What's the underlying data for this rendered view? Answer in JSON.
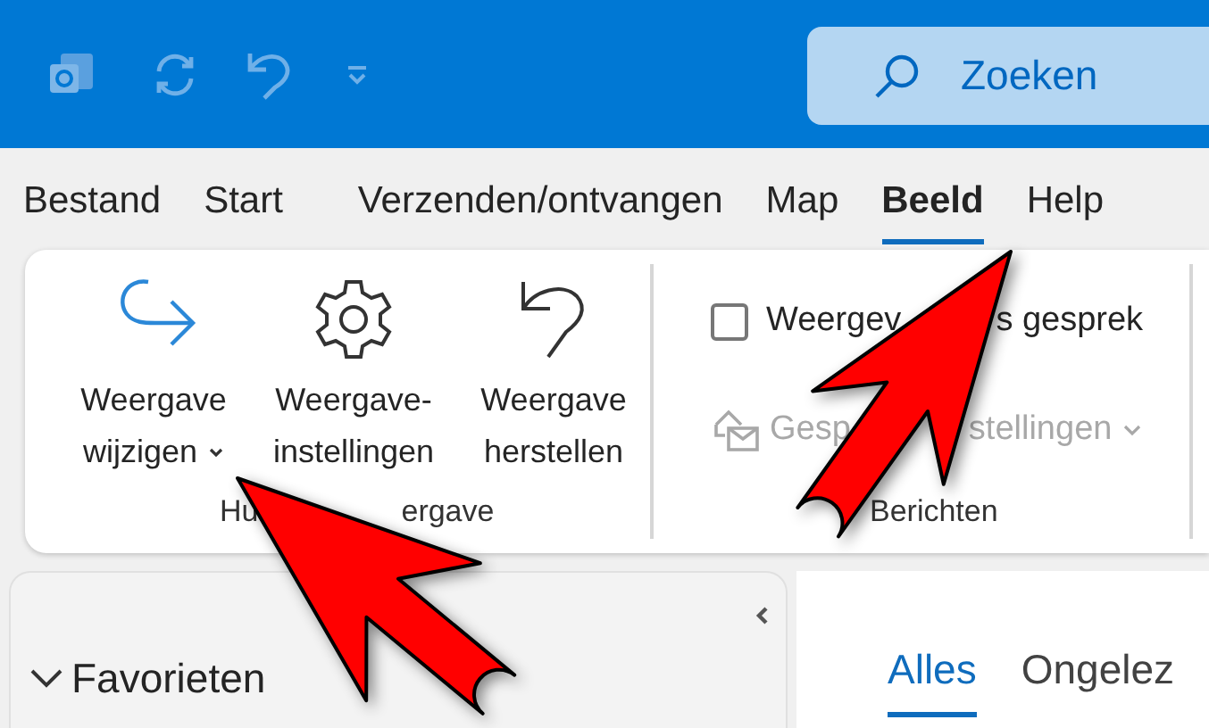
{
  "search": {
    "placeholder": "Zoeken"
  },
  "menu_tabs": [
    {
      "label": "Bestand",
      "selected": false
    },
    {
      "label": "Start",
      "selected": false
    },
    {
      "label": "Verzenden/ontvangen",
      "selected": false
    },
    {
      "label": "Map",
      "selected": false
    },
    {
      "label": "Beeld",
      "selected": true
    },
    {
      "label": "Help",
      "selected": false
    }
  ],
  "ribbon": {
    "groups": [
      {
        "label_visible_parts": [
          "Hu",
          "ergave"
        ],
        "items": [
          {
            "kind": "large",
            "label": "Weergave wijzigen",
            "dropdown": true
          },
          {
            "kind": "large",
            "label": "Weergave-instellingen",
            "dropdown": false
          },
          {
            "kind": "large",
            "label": "Weergave herstellen",
            "dropdown": false
          }
        ]
      },
      {
        "label_visible_parts": [
          "Berichten"
        ],
        "items": [
          {
            "kind": "checkbox",
            "label_visible_parts": [
              "Weergev",
              "s gesprek"
            ],
            "checked": false
          },
          {
            "kind": "small",
            "label_visible_parts": [
              "Gesp",
              "stellingen"
            ],
            "disabled": true,
            "dropdown": true
          }
        ]
      }
    ]
  },
  "folder_pane": {
    "favorites": {
      "label": "Favorieten",
      "expanded": true
    }
  },
  "message_tabs": [
    {
      "label": "Alles",
      "selected": true
    },
    {
      "label": "Ongelez",
      "selected": false
    }
  ]
}
